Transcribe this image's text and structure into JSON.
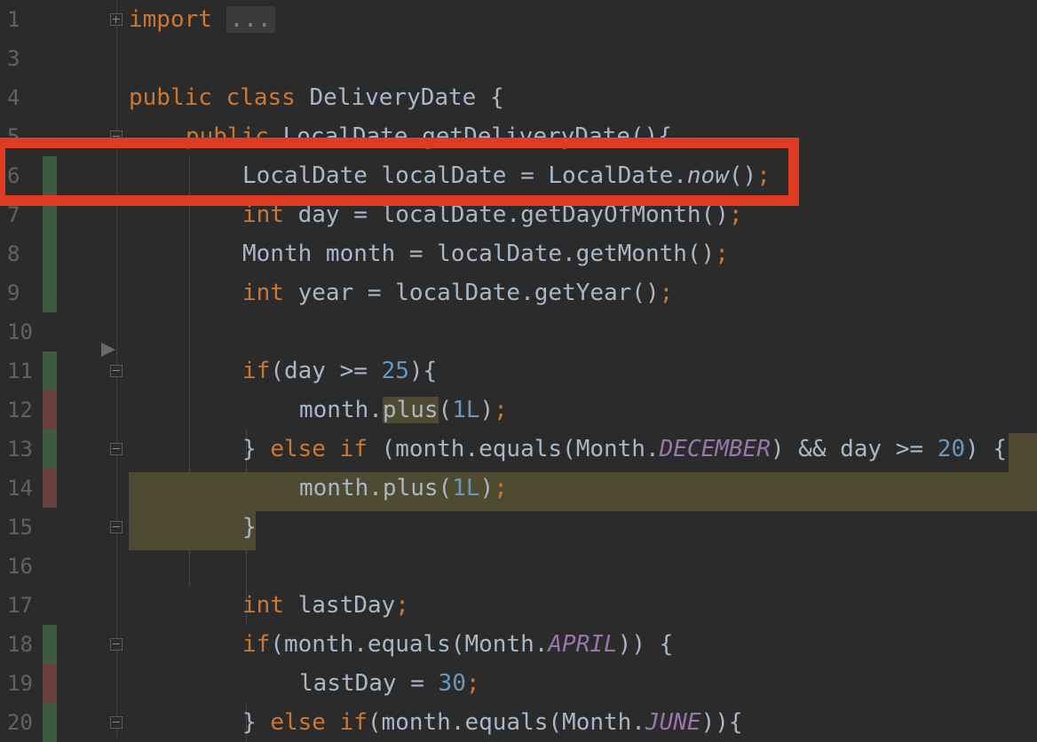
{
  "editor": {
    "language": "Java",
    "colors": {
      "background": "#2b2b2b",
      "keyword": "#cc7832",
      "number": "#6897bb",
      "constant": "#9876aa",
      "text": "#a9b7c6",
      "vcs_added": "#3f5b3f",
      "vcs_modified": "#6b3f40",
      "highlight": "#4f4b33",
      "annotation_box": "#e03a22"
    },
    "lines": [
      {
        "n": "1",
        "tokens": [
          {
            "t": "import",
            "c": "kw"
          },
          {
            "t": " ",
            "c": ""
          },
          {
            "t": "...",
            "c": "folded"
          }
        ]
      },
      {
        "n": "3",
        "tokens": []
      },
      {
        "n": "4",
        "tokens": [
          {
            "t": "public class",
            "c": "kw"
          },
          {
            "t": " DeliveryDate {",
            "c": ""
          }
        ]
      },
      {
        "n": "5",
        "tokens": [
          {
            "t": "public",
            "c": "kw"
          },
          {
            "t": " LocalDate getDeliveryDate(){",
            "c": ""
          }
        ]
      },
      {
        "n": "6",
        "tokens": [
          {
            "t": "LocalDate localDate = LocalDate.",
            "c": ""
          },
          {
            "t": "now",
            "c": "ital"
          },
          {
            "t": "()",
            "c": ""
          },
          {
            "t": ";",
            "c": "kw"
          }
        ]
      },
      {
        "n": "7",
        "tokens": [
          {
            "t": "int",
            "c": "kw"
          },
          {
            "t": " day = localDate.getDayOfMonth()",
            "c": ""
          },
          {
            "t": ";",
            "c": "kw"
          }
        ]
      },
      {
        "n": "8",
        "tokens": [
          {
            "t": "Month month = localDate.getMonth()",
            "c": ""
          },
          {
            "t": ";",
            "c": "kw"
          }
        ]
      },
      {
        "n": "9",
        "tokens": [
          {
            "t": "int",
            "c": "kw"
          },
          {
            "t": " year = localDate.getYear()",
            "c": ""
          },
          {
            "t": ";",
            "c": "kw"
          }
        ]
      },
      {
        "n": "10",
        "tokens": []
      },
      {
        "n": "11",
        "tokens": [
          {
            "t": "if",
            "c": "kw"
          },
          {
            "t": "(day >= ",
            "c": ""
          },
          {
            "t": "25",
            "c": "num"
          },
          {
            "t": "){",
            "c": ""
          }
        ]
      },
      {
        "n": "12",
        "tokens": [
          {
            "t": "month.",
            "c": ""
          },
          {
            "t": "plus",
            "c": "hlword"
          },
          {
            "t": "(",
            "c": ""
          },
          {
            "t": "1L",
            "c": "num"
          },
          {
            "t": ")",
            "c": ""
          },
          {
            "t": ";",
            "c": "kw"
          }
        ]
      },
      {
        "n": "13",
        "tokens": [
          {
            "t": "} ",
            "c": ""
          },
          {
            "t": "else if",
            "c": "kw"
          },
          {
            "t": " (month.equals(Month.",
            "c": ""
          },
          {
            "t": "DECEMBER",
            "c": "const"
          },
          {
            "t": ") && day >= ",
            "c": ""
          },
          {
            "t": "20",
            "c": "num"
          },
          {
            "t": ") {",
            "c": ""
          }
        ]
      },
      {
        "n": "14",
        "tokens": [
          {
            "t": "month.plus(",
            "c": ""
          },
          {
            "t": "1L",
            "c": "num"
          },
          {
            "t": ")",
            "c": ""
          },
          {
            "t": ";",
            "c": "kw"
          }
        ]
      },
      {
        "n": "15",
        "tokens": [
          {
            "t": "}",
            "c": ""
          }
        ]
      },
      {
        "n": "16",
        "tokens": []
      },
      {
        "n": "17",
        "tokens": [
          {
            "t": "int",
            "c": "kw"
          },
          {
            "t": " lastDay",
            "c": ""
          },
          {
            "t": ";",
            "c": "kw"
          }
        ]
      },
      {
        "n": "18",
        "tokens": [
          {
            "t": "if",
            "c": "kw"
          },
          {
            "t": "(month.equals(Month.",
            "c": ""
          },
          {
            "t": "APRIL",
            "c": "const"
          },
          {
            "t": ")) {",
            "c": ""
          }
        ]
      },
      {
        "n": "19",
        "tokens": [
          {
            "t": "lastDay = ",
            "c": ""
          },
          {
            "t": "30",
            "c": "num"
          },
          {
            "t": ";",
            "c": "kw"
          }
        ]
      },
      {
        "n": "20",
        "tokens": [
          {
            "t": "} ",
            "c": ""
          },
          {
            "t": "else if",
            "c": "kw"
          },
          {
            "t": "(month.equals(Month.",
            "c": ""
          },
          {
            "t": "JUNE",
            "c": "const"
          },
          {
            "t": ")){",
            "c": ""
          }
        ]
      }
    ]
  }
}
